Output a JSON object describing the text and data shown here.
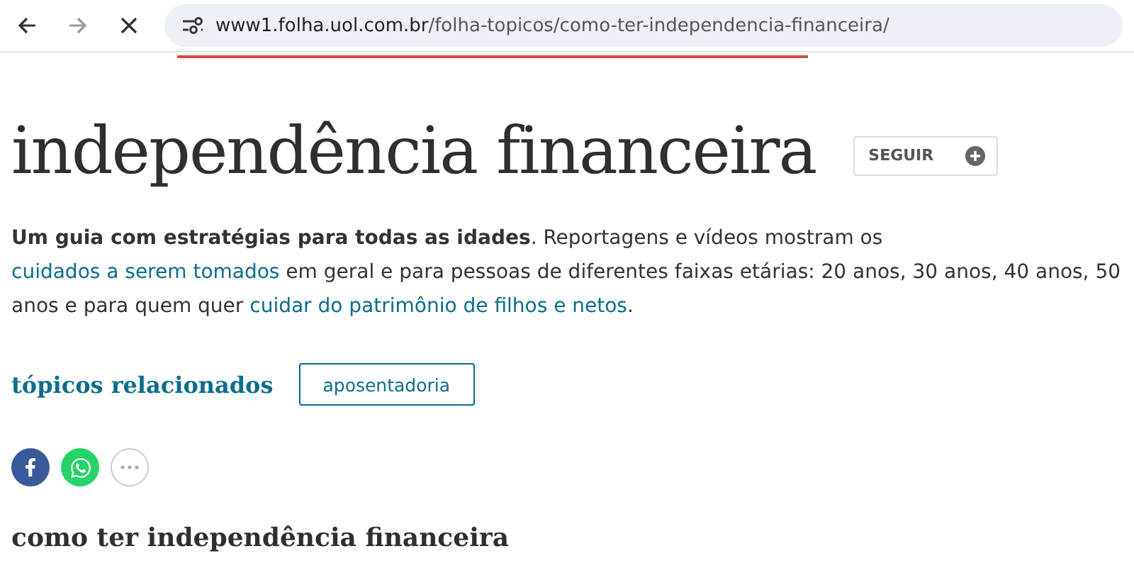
{
  "browser": {
    "url_host": "www1.folha.uol.com.br",
    "url_path": "/folha-topicos/como-ter-independencia-financeira/",
    "loading": true
  },
  "topic": {
    "title": "independência financeira",
    "follow_button": "SEGUIR"
  },
  "description": [
    {
      "kind": "bold",
      "text": "Um guia com estratégias para todas as idades"
    },
    {
      "kind": "text",
      "text": ". Reportagens e vídeos mostram os "
    },
    {
      "kind": "link",
      "text": "cuidados a serem tomados"
    },
    {
      "kind": "text",
      "text": " em geral e para pessoas de diferentes faixas etárias: 20 anos, 30 anos, 40 anos, 50 anos e para quem quer "
    },
    {
      "kind": "link",
      "text": "cuidar do patrimônio de filhos e netos"
    },
    {
      "kind": "text",
      "text": "."
    }
  ],
  "related": {
    "heading": "tópicos relacionados",
    "tags": [
      "aposentadoria"
    ]
  },
  "share": [
    {
      "kind": "facebook"
    },
    {
      "kind": "whatsapp"
    },
    {
      "kind": "more"
    }
  ],
  "section_heading": "como ter independência financeira"
}
